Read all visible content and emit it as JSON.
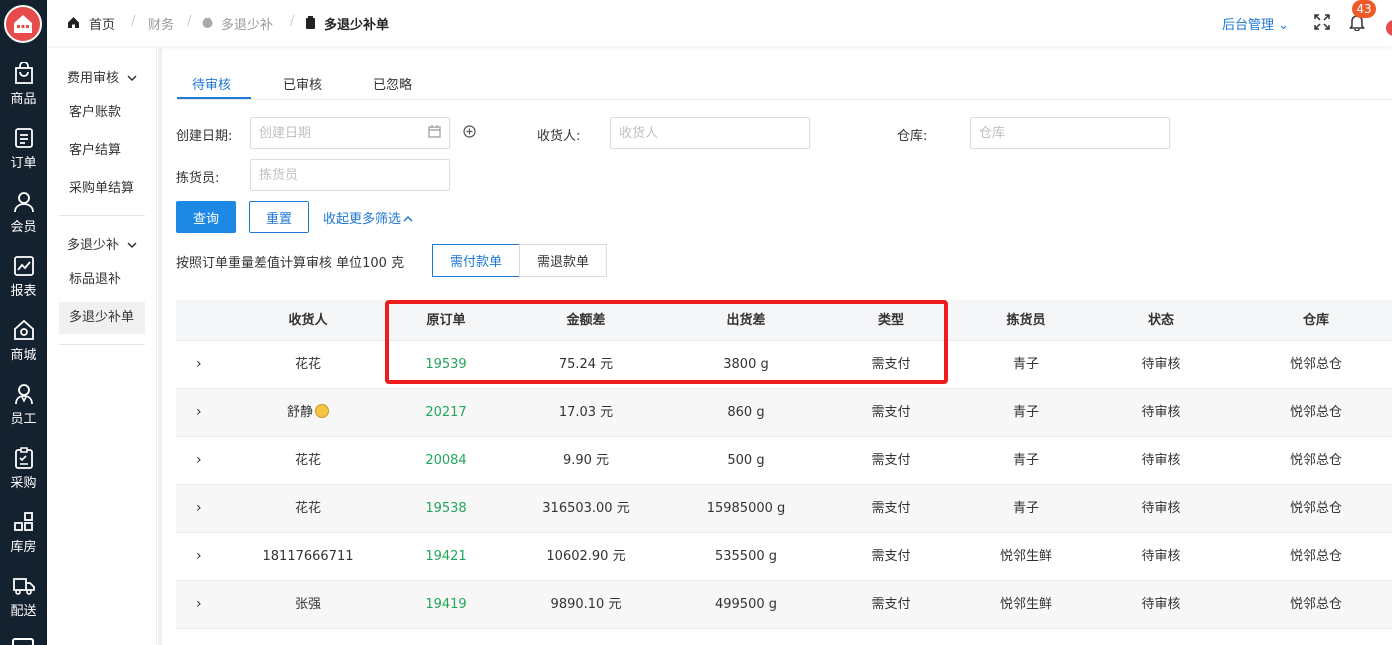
{
  "left_nav": [
    {
      "label": "商品",
      "icon": "bag-icon"
    },
    {
      "label": "订单",
      "icon": "document-icon"
    },
    {
      "label": "会员",
      "icon": "user-icon"
    },
    {
      "label": "报表",
      "icon": "chart-icon"
    },
    {
      "label": "商城",
      "icon": "house-icon"
    },
    {
      "label": "员工",
      "icon": "employee-icon"
    },
    {
      "label": "采购",
      "icon": "clipboard-icon"
    },
    {
      "label": "库房",
      "icon": "grid-icon"
    },
    {
      "label": "配送",
      "icon": "truck-icon"
    }
  ],
  "breadcrumb": {
    "home": "首页",
    "finance": "财务",
    "parent": "多退少补",
    "current": "多退少补单"
  },
  "header": {
    "admin_menu": "后台管理",
    "notification_count": "43"
  },
  "sub_nav": {
    "group1": "费用审核",
    "group1_items": [
      "客户账款",
      "客户结算",
      "采购单结算"
    ],
    "group2": "多退少补",
    "group2_items": [
      "标品退补",
      "多退少补单"
    ]
  },
  "tabs": [
    "待审核",
    "已审核",
    "已忽略"
  ],
  "filters": {
    "create_date_label": "创建日期:",
    "create_date_placeholder": "创建日期",
    "receiver_label": "收货人:",
    "receiver_placeholder": "收货人",
    "warehouse_label": "仓库:",
    "warehouse_placeholder": "仓库",
    "picker_label": "拣货员:",
    "picker_placeholder": "拣货员",
    "query_button": "查询",
    "reset_button": "重置",
    "collapse_link": "收起更多筛选"
  },
  "hint_text": "按照订单重量差值计算审核 单位100 克",
  "toggle": {
    "pay": "需付款单",
    "refund": "需退款单"
  },
  "table": {
    "headers": [
      "收货人",
      "原订单",
      "金额差",
      "出货差",
      "类型",
      "拣货员",
      "状态",
      "仓库"
    ],
    "rows": [
      {
        "receiver": "花花",
        "order": "19539",
        "amount": "75.24 元",
        "weight": "3800 g",
        "type": "需支付",
        "picker": "青子",
        "status": "待审核",
        "warehouse": "悦邻总仓"
      },
      {
        "receiver": "舒静",
        "order": "20217",
        "amount": "17.03 元",
        "weight": "860 g",
        "type": "需支付",
        "picker": "青子",
        "status": "待审核",
        "warehouse": "悦邻总仓"
      },
      {
        "receiver": "花花",
        "order": "20084",
        "amount": "9.90 元",
        "weight": "500 g",
        "type": "需支付",
        "picker": "青子",
        "status": "待审核",
        "warehouse": "悦邻总仓"
      },
      {
        "receiver": "花花",
        "order": "19538",
        "amount": "316503.00 元",
        "weight": "15985000 g",
        "type": "需支付",
        "picker": "青子",
        "status": "待审核",
        "warehouse": "悦邻总仓"
      },
      {
        "receiver": "18117666711",
        "order": "19421",
        "amount": "10602.90 元",
        "weight": "535500 g",
        "type": "需支付",
        "picker": "悦邻生鲜",
        "status": "待审核",
        "warehouse": "悦邻总仓"
      },
      {
        "receiver": "张强",
        "order": "19419",
        "amount": "9890.10 元",
        "weight": "499500 g",
        "type": "需支付",
        "picker": "悦邻生鲜",
        "status": "待审核",
        "warehouse": "悦邻总仓"
      }
    ]
  },
  "colors": {
    "sidebar": "#14212f",
    "primary": "#1e88e5",
    "link": "#1e78d6",
    "order_link": "#22a65a",
    "highlight_box": "#ee1c1c",
    "badge": "#f05a28"
  }
}
